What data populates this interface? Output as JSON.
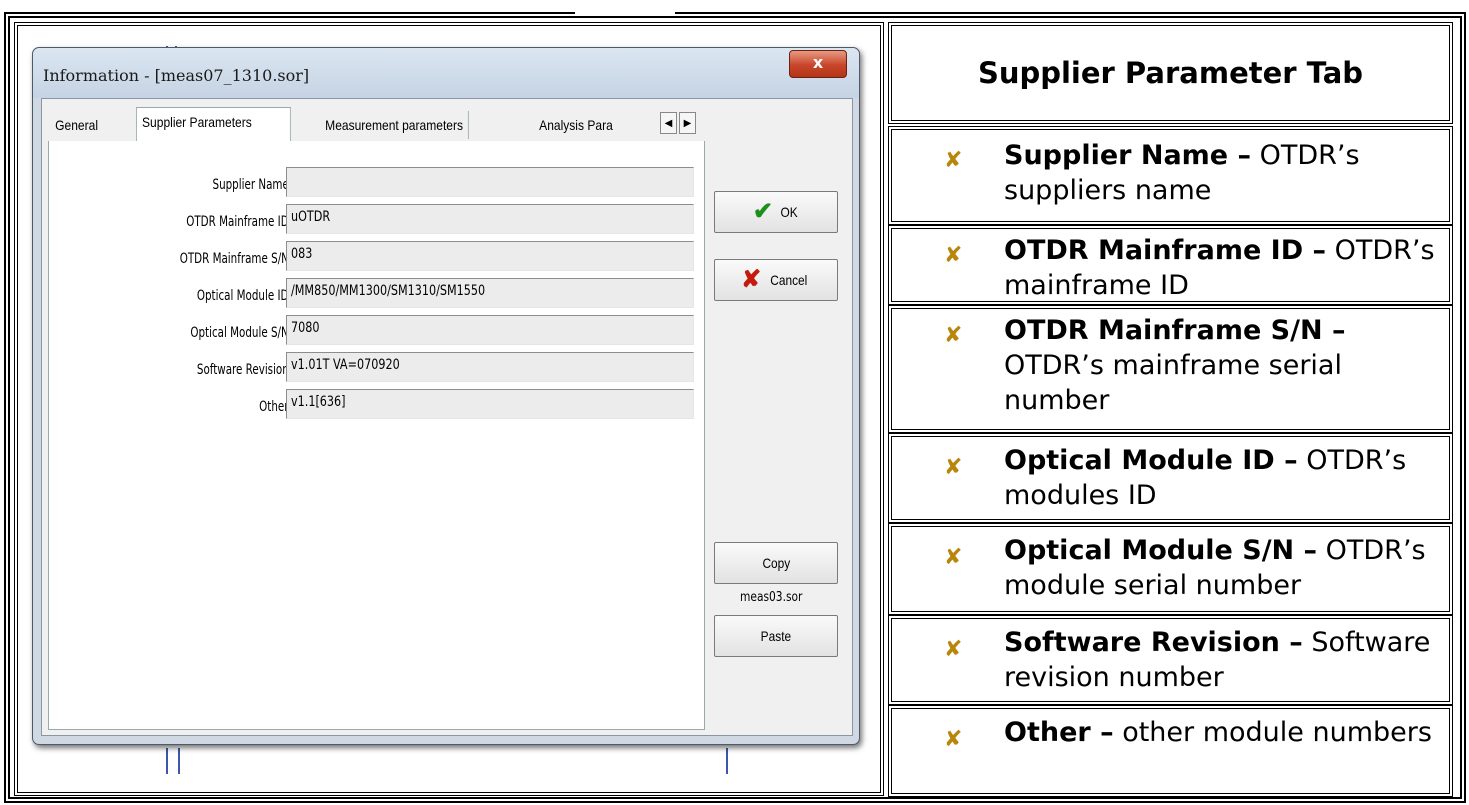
{
  "dialog": {
    "title": "Information - [meas07_1310.sor]",
    "close_label": "x",
    "tabs": [
      "General",
      "Supplier Parameters",
      "Measurement parameters",
      "Analysis Para"
    ],
    "fields": [
      {
        "label": "Supplier Name:",
        "value": ""
      },
      {
        "label": "OTDR Mainframe ID:",
        "value": "uOTDR"
      },
      {
        "label": "OTDR Mainframe S/N:",
        "value": "083"
      },
      {
        "label": "Optical Module ID:",
        "value": "/MM850/MM1300/SM1310/SM1550"
      },
      {
        "label": "Optical Module S/N:",
        "value": "7080"
      },
      {
        "label": "Software Revision:",
        "value": "v1.01T  VA=070920"
      },
      {
        "label": "Other:",
        "value": "v1.1[636]"
      }
    ],
    "ok_label": "OK",
    "cancel_label": "Cancel",
    "copy_label": "Copy",
    "paste_label": "Paste",
    "clipboard_file": "meas03.sor"
  },
  "panel": {
    "heading": "Supplier Parameter Tab",
    "items": [
      {
        "term": "Supplier Name –",
        "desc": " OTDR’s suppliers name"
      },
      {
        "term": "OTDR Mainframe ID –",
        "desc": " OTDR’s mainframe ID"
      },
      {
        "term": "OTDR Mainframe S/N –",
        "desc": " OTDR’s mainframe serial number"
      },
      {
        "term": "Optical Module ID –",
        "desc": " OTDR’s modules ID"
      },
      {
        "term": "Optical Module S/N –",
        "desc": " OTDR’s module serial number"
      },
      {
        "term": "Software Revision –",
        "desc": " Software revision number"
      },
      {
        "term": "Other –",
        "desc": " other module numbers"
      }
    ]
  },
  "colors": {
    "bullet": "#b8860b",
    "ok_check": "#1d8f1d",
    "cancel_x": "#c51b0f",
    "close_button": "#c9452a"
  },
  "icons": {
    "bullet": "x-bullet-icon",
    "ok": "check-icon",
    "cancel": "cross-icon"
  }
}
